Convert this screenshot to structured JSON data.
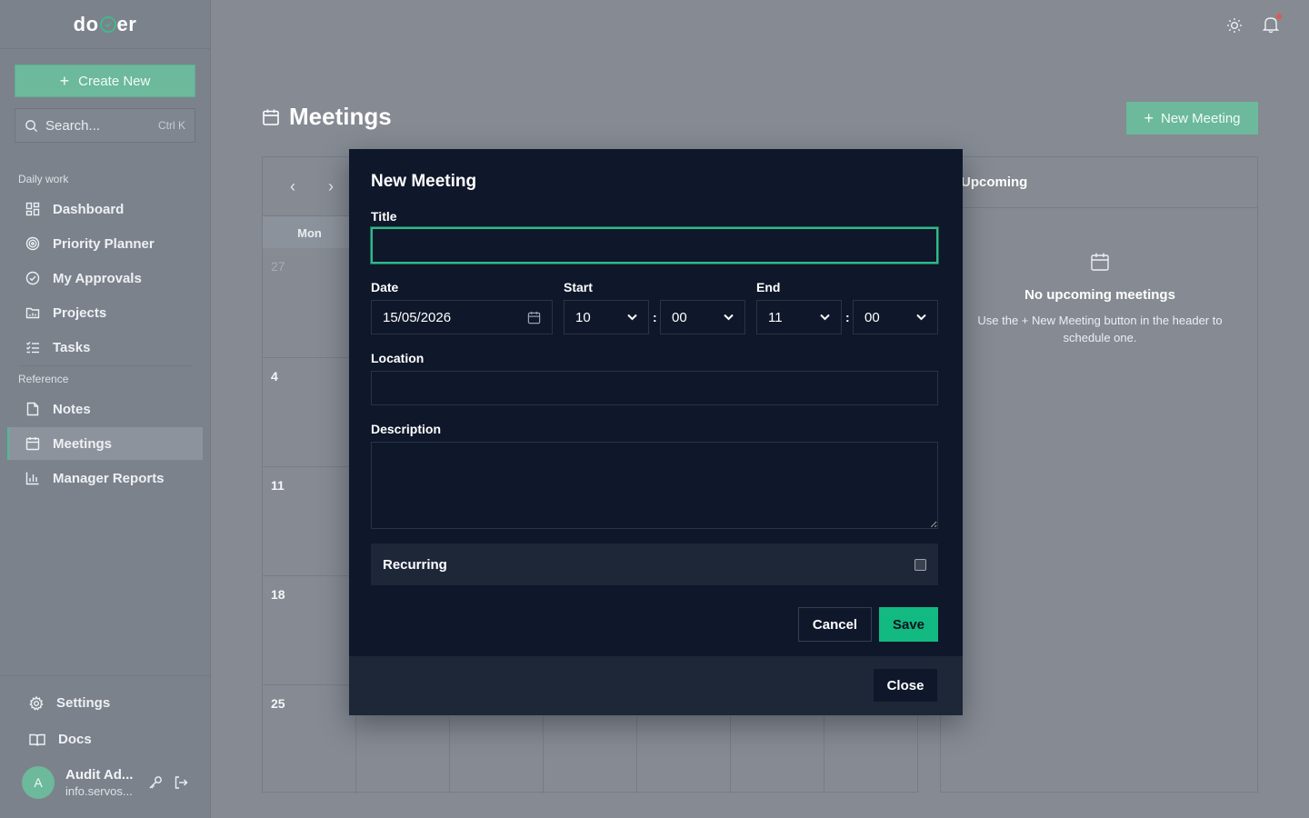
{
  "app": {
    "logo_left": "do",
    "logo_right": "er",
    "colors": {
      "accent": "#12b981",
      "modal_bg": "#0f172a",
      "overlay": "#858a93",
      "notification": "#e5574b"
    }
  },
  "sidebar": {
    "create_label": "Create New",
    "search": {
      "placeholder": "Search...",
      "shortcut": "Ctrl K"
    },
    "sections": [
      {
        "label": "Daily work",
        "items": [
          {
            "label": "Dashboard",
            "icon": "grid-icon"
          },
          {
            "label": "Priority Planner",
            "icon": "target-icon"
          },
          {
            "label": "My Approvals",
            "icon": "check-circle-icon"
          },
          {
            "label": "Projects",
            "icon": "folder-icon"
          },
          {
            "label": "Tasks",
            "icon": "list-check-icon"
          }
        ]
      },
      {
        "label": "Reference",
        "items": [
          {
            "label": "Notes",
            "icon": "file-icon"
          },
          {
            "label": "Meetings",
            "icon": "calendar-icon",
            "active": true
          },
          {
            "label": "Manager Reports",
            "icon": "bar-chart-icon"
          }
        ]
      }
    ],
    "bottom": {
      "settings": "Settings",
      "docs": "Docs"
    },
    "user": {
      "initial": "A",
      "name": "Audit Ad...",
      "email": "info.servos..."
    }
  },
  "page": {
    "title": "Meetings",
    "new_meeting_label": "New Meeting"
  },
  "calendar": {
    "weekday_header": "Mon",
    "week_start_days": [
      "27",
      "4",
      "11",
      "18",
      "25"
    ]
  },
  "upcoming": {
    "title": "Upcoming",
    "empty_title": "No upcoming meetings",
    "empty_desc": "Use the + New Meeting button in the header to schedule one."
  },
  "modal": {
    "title": "New Meeting",
    "labels": {
      "title": "Title",
      "date": "Date",
      "start": "Start",
      "end": "End",
      "location": "Location",
      "description": "Description",
      "recurring": "Recurring"
    },
    "values": {
      "title": "",
      "date": "15/05/2026",
      "start_hour": "10",
      "start_min": "00",
      "end_hour": "11",
      "end_min": "00",
      "location": "",
      "description": "",
      "recurring": false
    },
    "time_separator": ":",
    "cancel_label": "Cancel",
    "save_label": "Save",
    "close_label": "Close"
  }
}
